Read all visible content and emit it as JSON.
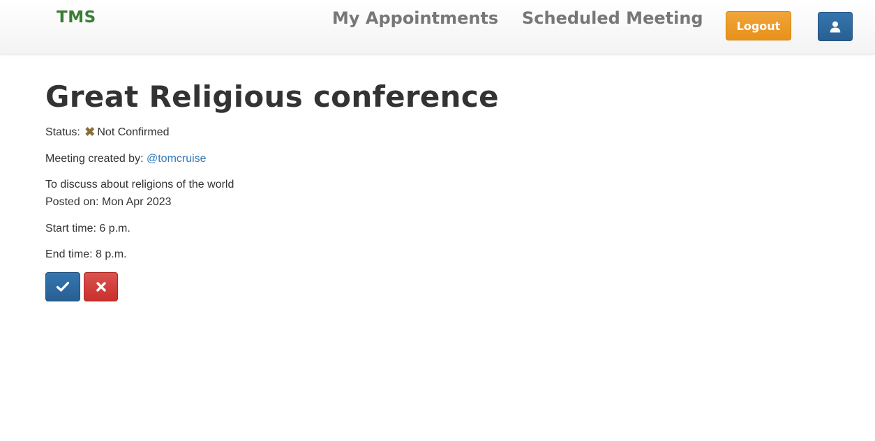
{
  "navbar": {
    "brand": "TMS",
    "links": [
      "My Appointments",
      "Scheduled Meeting"
    ],
    "logout_label": "Logout",
    "user_icon": "user-icon"
  },
  "meeting": {
    "title": "Great Religious conference",
    "status_prefix": "Status:",
    "status_icon": "x-icon",
    "status_text": "Not Confirmed",
    "created_by_prefix": "Meeting created by:",
    "created_by_user": "@tomcruise",
    "description": "To discuss about religions of the world",
    "posted_on": "Posted on: Mon Apr 2023",
    "start_time": "Start time: 6 p.m.",
    "end_time": "End time: 8 p.m."
  },
  "actions": {
    "confirm_icon": "check-icon",
    "decline_icon": "close-icon"
  },
  "colors": {
    "brand": "#3a7d35",
    "logout": "#ec9a26",
    "primary": "#2e6da4",
    "danger": "#d43f3a",
    "link": "#337ab7",
    "status_icon": "#8b6f3a"
  }
}
